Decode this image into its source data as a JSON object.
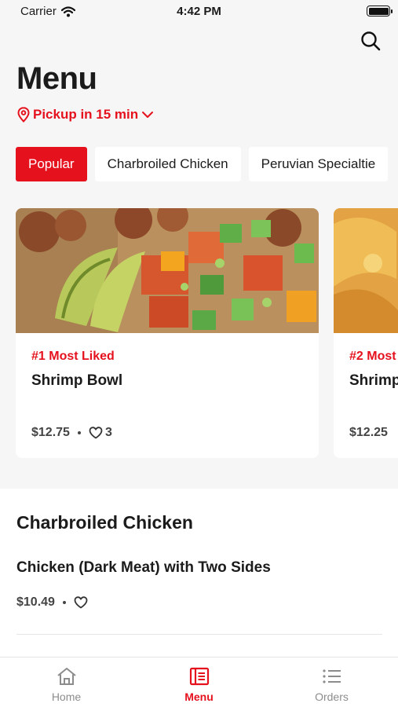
{
  "status": {
    "carrier": "Carrier",
    "time": "4:42 PM"
  },
  "header": {
    "title": "Menu",
    "pickup": "Pickup in 15 min"
  },
  "categories": [
    "Popular",
    "Charbroiled Chicken",
    "Peruvian Specialtie"
  ],
  "featured": [
    {
      "rank": "#1 Most Liked",
      "name": "Shrimp Bowl",
      "price": "$12.75",
      "likes": "3"
    },
    {
      "rank": "#2 Most",
      "name": "Shrimp",
      "price": "$12.25"
    }
  ],
  "section": {
    "title": "Charbroiled Chicken",
    "items": [
      {
        "name": "Chicken (Dark Meat) with Two Sides",
        "price": "$10.49"
      }
    ]
  },
  "tabbar": [
    {
      "label": "Home",
      "icon": "home-icon"
    },
    {
      "label": "Menu",
      "icon": "menu-icon"
    },
    {
      "label": "Orders",
      "icon": "list-icon"
    }
  ],
  "colors": {
    "accent": "#e5121e",
    "background": "#f6f6f6"
  }
}
